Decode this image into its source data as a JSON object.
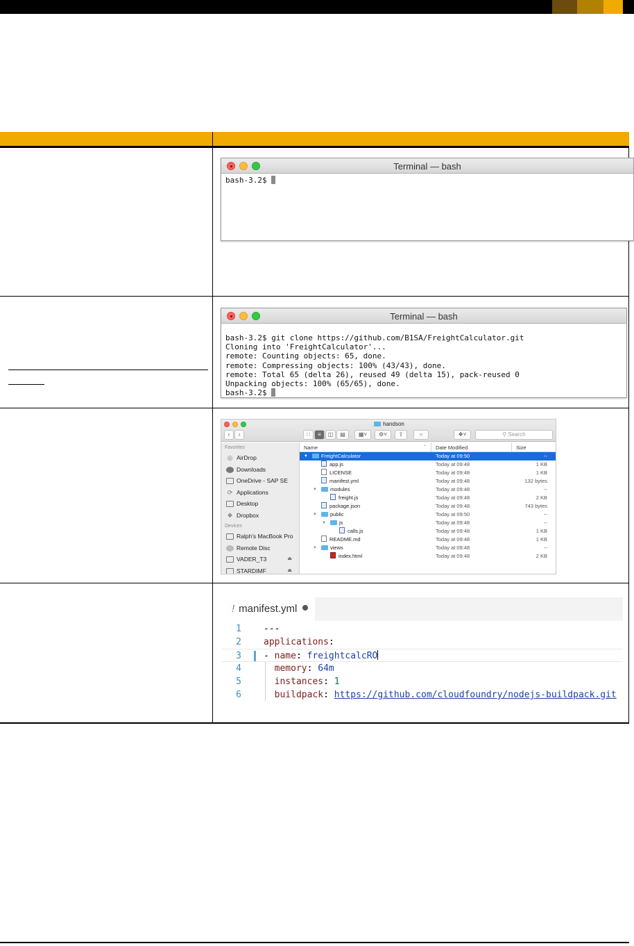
{
  "header": {
    "band_colors": [
      "#6b4b0e",
      "#b08200",
      "#f0ab00"
    ],
    "accent": "#f0ab00"
  },
  "terminal1": {
    "title": "Terminal — bash",
    "lines": [
      "bash-3.2$ "
    ]
  },
  "terminal2": {
    "title": "Terminal — bash",
    "lines": [
      "bash-3.2$ git clone https://github.com/B1SA/FreightCalculator.git",
      "Cloning into 'FreightCalculator'...",
      "remote: Counting objects: 65, done.",
      "remote: Compressing objects: 100% (43/43), done.",
      "remote: Total 65 (delta 26), reused 49 (delta 15), pack-reused 0",
      "Unpacking objects: 100% (65/65), done.",
      "bash-3.2$ "
    ]
  },
  "finder": {
    "window_title": "handson",
    "search_placeholder": "Search",
    "sidebar": {
      "favorites_label": "Favorites",
      "favorites": [
        {
          "label": "AirDrop",
          "icon": "airdrop-icon"
        },
        {
          "label": "Downloads",
          "icon": "downloads-icon"
        },
        {
          "label": "OneDrive - SAP SE",
          "icon": "folder-icon"
        },
        {
          "label": "Applications",
          "icon": "applications-icon"
        },
        {
          "label": "Desktop",
          "icon": "desktop-icon"
        },
        {
          "label": "Dropbox",
          "icon": "dropbox-icon"
        }
      ],
      "devices_label": "Devices",
      "devices": [
        {
          "label": "Ralph's MacBook Pro",
          "icon": "laptop-icon"
        },
        {
          "label": "Remote Disc",
          "icon": "disc-icon"
        },
        {
          "label": "VADER_T3",
          "icon": "drive-icon"
        },
        {
          "label": "STARDIMF",
          "icon": "drive-icon"
        }
      ]
    },
    "columns": {
      "name": "Name",
      "date": "Date Modified",
      "size": "Size"
    },
    "rows": [
      {
        "name": "FreightCalculator",
        "date": "Today at 09:50",
        "size": "--",
        "type": "folder",
        "level": 0,
        "open": true,
        "selected": true
      },
      {
        "name": "app.js",
        "date": "Today at 09:48",
        "size": "1 KB",
        "type": "js",
        "level": 1
      },
      {
        "name": "LICENSE",
        "date": "Today at 09:48",
        "size": "1 KB",
        "type": "file",
        "level": 1
      },
      {
        "name": "manifest.yml",
        "date": "Today at 09:48",
        "size": "132 bytes",
        "type": "js",
        "level": 1
      },
      {
        "name": "modules",
        "date": "Today at 09:48",
        "size": "--",
        "type": "folder",
        "level": 1,
        "open": true
      },
      {
        "name": "freight.js",
        "date": "Today at 09:48",
        "size": "2 KB",
        "type": "js",
        "level": 2
      },
      {
        "name": "package.json",
        "date": "Today at 09:48",
        "size": "743 bytes",
        "type": "js",
        "level": 1
      },
      {
        "name": "public",
        "date": "Today at 09:50",
        "size": "--",
        "type": "folder",
        "level": 1,
        "open": true
      },
      {
        "name": "js",
        "date": "Today at 09:48",
        "size": "--",
        "type": "folder",
        "level": 2,
        "open": true
      },
      {
        "name": "calls.js",
        "date": "Today at 09:48",
        "size": "1 KB",
        "type": "js",
        "level": 3
      },
      {
        "name": "README.md",
        "date": "Today at 09:48",
        "size": "1 KB",
        "type": "file",
        "level": 1
      },
      {
        "name": "views",
        "date": "Today at 09:48",
        "size": "--",
        "type": "folder",
        "level": 1,
        "open": true
      },
      {
        "name": "index.html",
        "date": "Today at 09:48",
        "size": "2 KB",
        "type": "html",
        "level": 2
      }
    ]
  },
  "editor": {
    "tab_label": "manifest.yml",
    "lines": [
      {
        "num": "1",
        "text": "---"
      },
      {
        "num": "2",
        "key": "applications",
        "value": ""
      },
      {
        "num": "3",
        "key": "name",
        "value": "freightcalcRO",
        "dash": true
      },
      {
        "num": "4",
        "key": "memory",
        "value": "64m"
      },
      {
        "num": "5",
        "key": "instances",
        "value": "1"
      },
      {
        "num": "6",
        "key": "buildpack",
        "value": "https://github.com/cloudfoundry/nodejs-buildpack.git"
      }
    ]
  }
}
